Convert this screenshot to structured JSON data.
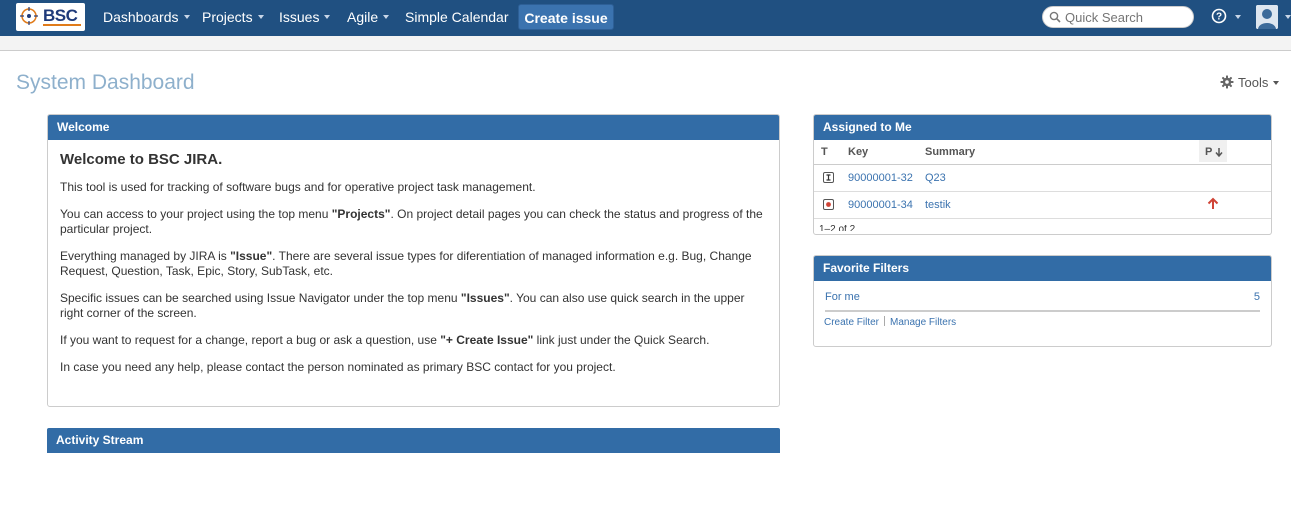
{
  "nav": {
    "logo_text": "BSC",
    "items": [
      {
        "label": "Dashboards",
        "has_menu": true
      },
      {
        "label": "Projects",
        "has_menu": true
      },
      {
        "label": "Issues",
        "has_menu": true
      },
      {
        "label": "Agile",
        "has_menu": true
      },
      {
        "label": "Simple Calendar",
        "has_menu": false
      }
    ],
    "create_label": "Create issue",
    "search_placeholder": "Quick Search"
  },
  "page": {
    "title": "System Dashboard",
    "tools_label": "Tools"
  },
  "welcome": {
    "header": "Welcome",
    "heading": "Welcome to BSC JIRA.",
    "p1": "This tool is used for tracking of software bugs and for operative project task management.",
    "p2_before": "You can access to your project using the top menu ",
    "p2_bold": "\"Projects\"",
    "p2_after": ". On project detail pages you can check the status and progress of the particular project.",
    "p3_before": "Everything managed by JIRA is ",
    "p3_bold": "\"Issue\"",
    "p3_after": ". There are several issue types for diferentiation of managed information e.g. Bug, Change Request, Question, Task, Epic, Story, SubTask, etc.",
    "p4_before": "Specific issues can be searched using Issue Navigator under the top menu ",
    "p4_bold": "\"Issues\"",
    "p4_after": ". You can also use quick search in the upper right corner of the screen.",
    "p5_before": "If you want to request for a change, report a bug or ask a question, use ",
    "p5_bold": "\"+ Create Issue\"",
    "p5_after": " link just under the Quick Search.",
    "p6": "In case you need any help, please contact the person nominated as primary BSC contact for you project."
  },
  "activity": {
    "header": "Activity Stream"
  },
  "assigned": {
    "header": "Assigned to Me",
    "columns": {
      "type": "T",
      "key": "Key",
      "summary": "Summary",
      "priority": "P"
    },
    "rows": [
      {
        "type_icon": "improvement-icon",
        "key": "90000001-32",
        "summary": "Q23",
        "priority": ""
      },
      {
        "type_icon": "bug-icon",
        "key": "90000001-34",
        "summary": "testik",
        "priority": "major-priority-icon"
      }
    ],
    "pager": "1–2 of 2"
  },
  "filters": {
    "header": "Favorite Filters",
    "items": [
      {
        "name": "For me",
        "count": "5"
      }
    ],
    "create_label": "Create Filter",
    "manage_label": "Manage Filters"
  },
  "colors": {
    "topbar": "#205081",
    "gadget_header": "#326ca6",
    "link": "#3b73af",
    "title": "#8eb0cc"
  }
}
